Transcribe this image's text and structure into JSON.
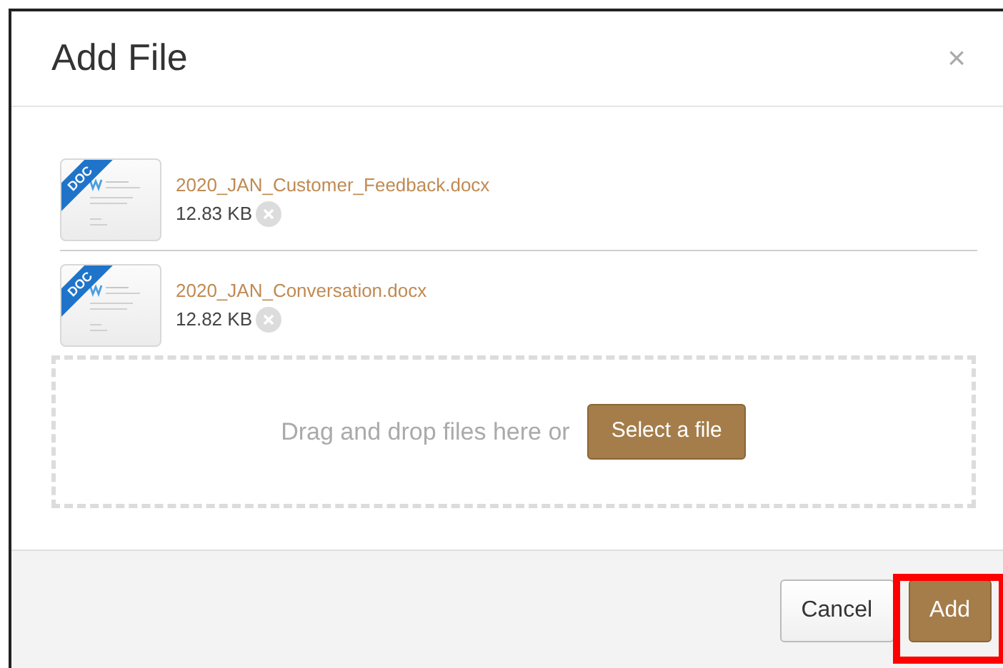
{
  "dialog": {
    "title": "Add File",
    "close": "×"
  },
  "files": [
    {
      "badge": "DOC",
      "name": "2020_JAN_Customer_Feedback.docx",
      "size": "12.83 KB"
    },
    {
      "badge": "DOC",
      "name": "2020_JAN_Conversation.docx",
      "size": "12.82 KB"
    }
  ],
  "dropzone": {
    "text": "Drag and drop files here or",
    "button": "Select a file"
  },
  "buttons": [
    {
      "label": "Cancel",
      "kind": "secondary",
      "highlighted": false
    },
    {
      "label": "Add",
      "kind": "primary",
      "highlighted": true
    }
  ]
}
